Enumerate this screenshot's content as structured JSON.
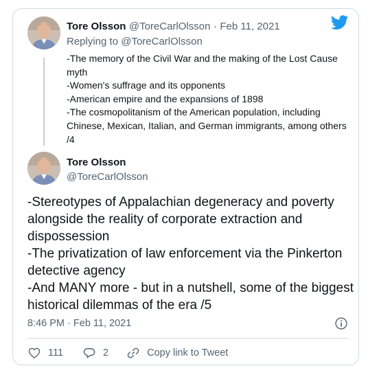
{
  "parent_tweet": {
    "author_name": "Tore Olsson",
    "author_handle": "@ToreCarlOlsson",
    "separator": "·",
    "date": "Feb 11, 2021",
    "replying_label": "Replying to",
    "replying_handle": "@ToreCarlOlsson",
    "lines": [
      "-The memory of the Civil War and the making of the Lost Cause myth",
      "-Women's suffrage and its opponents",
      "-American empire and the expansions of 1898",
      "-The cosmopolitanism of the American population, including Chinese, Mexican, Italian, and German immigrants, among others /4"
    ]
  },
  "main_tweet": {
    "author_name": "Tore Olsson",
    "author_handle": "@ToreCarlOlsson",
    "lines": [
      "-Stereotypes of Appalachian degeneracy and poverty alongside the reality of corporate extraction and dispossession",
      "-The privatization of law enforcement via the Pinkerton detective agency",
      "-And MANY more - but in a nutshell, some of the biggest historical dilemmas of the era  /5"
    ],
    "time": "8:46 PM",
    "separator": "·",
    "date": "Feb 11, 2021",
    "likes": "111",
    "replies": "2",
    "copy_link_label": "Copy link to Tweet"
  },
  "icons": {
    "brand": "twitter-bird-icon",
    "info": "info-icon",
    "like": "heart-icon",
    "reply": "reply-bubble-icon",
    "link": "link-icon"
  },
  "colors": {
    "twitter_blue": "#1d9bf0",
    "muted": "#536471",
    "text": "#0f1419",
    "border": "#cfd9de"
  }
}
